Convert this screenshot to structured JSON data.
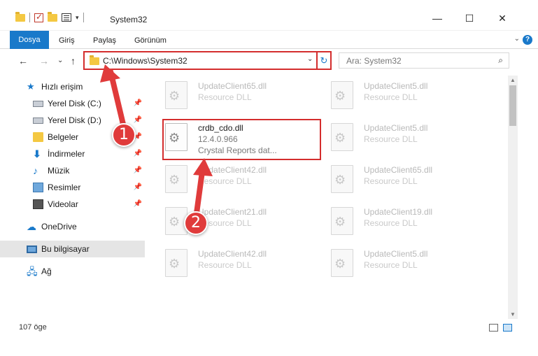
{
  "window": {
    "title": "System32",
    "minimize_glyph": "—",
    "maximize_glyph": "☐",
    "close_glyph": "✕"
  },
  "ribbon": {
    "tabs": [
      "Dosya",
      "Giriş",
      "Paylaş",
      "Görünüm"
    ],
    "expand_glyph": "⌄",
    "help_glyph": "?"
  },
  "navigation": {
    "back_glyph": "←",
    "forward_glyph": "→",
    "recent_glyph": "⌄",
    "up_glyph": "↑"
  },
  "address": {
    "path": "C:\\Windows\\System32",
    "drop_glyph": "⌄",
    "refresh_glyph": "↻"
  },
  "search": {
    "placeholder": "Ara: System32",
    "icon_glyph": "⌕"
  },
  "sidebar": {
    "items": [
      {
        "label": "Hızlı erişim",
        "icon": "star-icon",
        "pinned": false
      },
      {
        "label": "Yerel Disk (C:)",
        "icon": "disk-icon",
        "pinned": true
      },
      {
        "label": "Yerel Disk (D:)",
        "icon": "disk-icon",
        "pinned": true
      },
      {
        "label": "Belgeler",
        "icon": "documents-icon",
        "pinned": true
      },
      {
        "label": "İndirmeler",
        "icon": "download-icon",
        "pinned": true
      },
      {
        "label": "Müzik",
        "icon": "music-icon",
        "pinned": true
      },
      {
        "label": "Resimler",
        "icon": "pictures-icon",
        "pinned": true
      },
      {
        "label": "Videolar",
        "icon": "videos-icon",
        "pinned": true
      },
      {
        "label": "OneDrive",
        "icon": "cloud-icon",
        "pinned": false
      },
      {
        "label": "Bu bilgisayar",
        "icon": "computer-icon",
        "pinned": false,
        "selected": true
      },
      {
        "label": "Ağ",
        "icon": "network-icon",
        "pinned": false
      }
    ],
    "pin_glyph": "📌"
  },
  "files": {
    "left_column": [
      {
        "name": "UpdateClient65.dll",
        "type": "Resource DLL"
      },
      {
        "name": "crdb_cdo.dll",
        "version": "12.4.0.966",
        "description": "Crystal Reports dat...",
        "focused": true
      },
      {
        "name": "UpdateClient42.dll",
        "type": "Resource DLL"
      },
      {
        "name": "UpdateClient21.dll",
        "type": "Resource DLL"
      },
      {
        "name": "UpdateClient42.dll",
        "type": "Resource DLL"
      }
    ],
    "right_column": [
      {
        "name": "UpdateClient5.dll",
        "type": "Resource DLL"
      },
      {
        "name": "UpdateClient5.dll",
        "type": "Resource DLL"
      },
      {
        "name": "UpdateClient65.dll",
        "type": "Resource DLL"
      },
      {
        "name": "UpdateClient19.dll",
        "type": "Resource DLL"
      },
      {
        "name": "UpdateClient5.dll",
        "type": "Resource DLL"
      }
    ]
  },
  "status": {
    "item_count": "107 öge"
  },
  "annotations": {
    "step1": "1",
    "step2": "2",
    "color": "#e03b3b"
  }
}
